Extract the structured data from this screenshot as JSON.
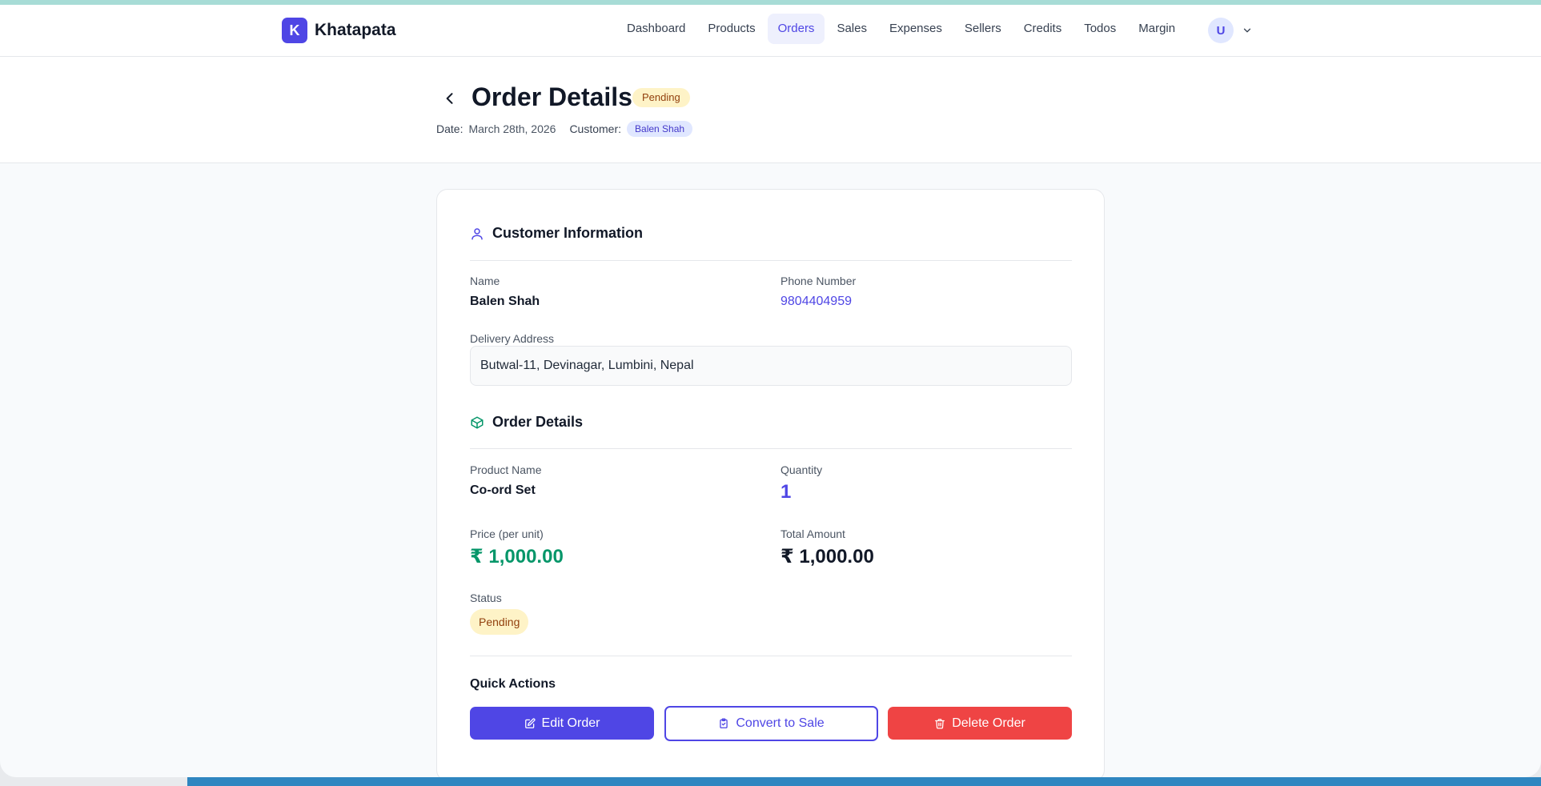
{
  "brand": {
    "logo_letter": "K",
    "name": "Khatapata"
  },
  "nav": {
    "links": [
      "Dashboard",
      "Products",
      "Orders",
      "Sales",
      "Expenses",
      "Sellers",
      "Credits",
      "Todos",
      "Margin"
    ],
    "active": "Orders"
  },
  "user": {
    "initial": "U"
  },
  "header": {
    "title": "Order Details",
    "status_badge": "Pending",
    "date_label": "Date:",
    "date_value": "March 28th, 2026",
    "customer_label": "Customer:",
    "customer_value": "Balen Shah"
  },
  "customer_info": {
    "title": "Customer Information",
    "name_label": "Name",
    "name_value": "Balen Shah",
    "phone_label": "Phone Number",
    "phone_value": "9804404959",
    "address_label": "Delivery Address",
    "address_value": "Butwal-11, Devinagar, Lumbini, Nepal"
  },
  "order_details": {
    "title": "Order Details",
    "product_label": "Product Name",
    "product_value": "Co-ord Set",
    "quantity_label": "Quantity",
    "quantity_value": "1",
    "price_label": "Price (per unit)",
    "price_value": "₹ 1,000.00",
    "total_label": "Total Amount",
    "total_value": "₹ 1,000.00",
    "status_label": "Status",
    "status_value": "Pending"
  },
  "quick_actions": {
    "title": "Quick Actions",
    "edit_label": "Edit Order",
    "convert_label": "Convert to Sale",
    "delete_label": "Delete Order"
  },
  "colors": {
    "accent": "#4f46e5",
    "success": "#059669",
    "danger": "#ef4444",
    "pending_bg": "#fef3c7",
    "pending_text": "#92400e"
  }
}
